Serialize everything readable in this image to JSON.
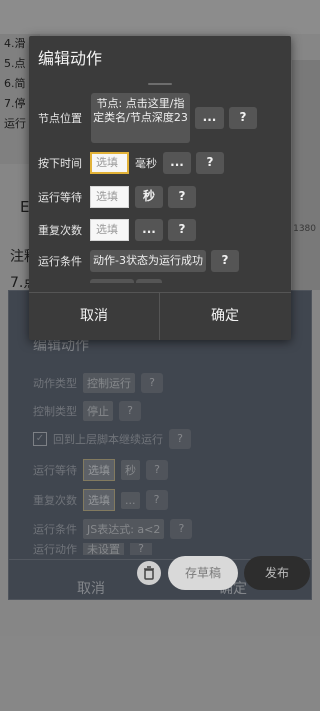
{
  "background": {
    "list_items": [
      "4.滑",
      "5.点",
      "6.简",
      "7.停",
      "运行"
    ],
    "hint_1": "注释",
    "hint_2": "7.点",
    "side_number": "1380",
    "letter": "E"
  },
  "ghost_dialog": {
    "title": "编辑动作",
    "rows": [
      {
        "label": "动作类型",
        "value": "控制运行",
        "help": "?"
      },
      {
        "label": "控制类型",
        "value": "停止",
        "help": "?"
      },
      {
        "label": "回到上层脚本继续运行",
        "help": "?"
      },
      {
        "label": "运行等待",
        "placeholder": "选填",
        "unit": "秒",
        "help": "?"
      },
      {
        "label": "重复次数",
        "placeholder": "选填",
        "more": "...",
        "help": "?"
      },
      {
        "label": "运行条件",
        "value": "JS表达式: a<2",
        "help": "?"
      },
      {
        "label": "运行动作",
        "value": "未设置",
        "help": "?"
      }
    ],
    "cancel": "取消",
    "confirm": "确定"
  },
  "dialog": {
    "title": "编辑动作",
    "node_position": {
      "label": "节点位置",
      "value": "节点: 点击这里/指定类名/节点深度23",
      "more": "...",
      "help": "?"
    },
    "press_time": {
      "label": "按下时间",
      "placeholder": "选填",
      "unit": "毫秒",
      "more": "...",
      "help": "?"
    },
    "run_wait": {
      "label": "运行等待",
      "placeholder": "选填",
      "unit": "秒",
      "help": "?"
    },
    "repeat": {
      "label": "重复次数",
      "placeholder": "选填",
      "more": "...",
      "help": "?"
    },
    "condition": {
      "label": "运行条件",
      "value": "动作-3状态为运行成功",
      "help": "?"
    },
    "cancel": "取消",
    "confirm": "确定"
  },
  "actions": {
    "draft": "存草稿",
    "publish": "发布"
  },
  "colors": {
    "dialog_bg": "#3b3b3b",
    "chip_bg": "#555555",
    "focus_border": "#e2b238"
  }
}
